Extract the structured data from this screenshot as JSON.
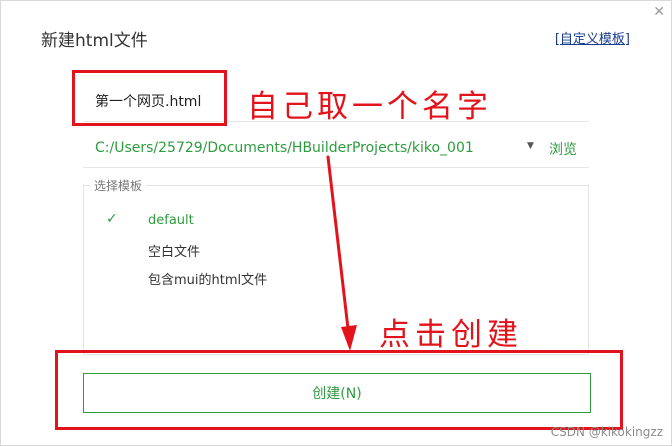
{
  "dialog": {
    "title": "新建html文件",
    "close_glyph": "✕",
    "custom_template_link": "[自定义模板]",
    "filename_value": "第一个网页.html",
    "path_value": "C:/Users/25729/Documents/HBuilderProjects/kiko_001",
    "path_dropdown_glyph": "▼",
    "browse_label": "浏览",
    "template_section_label": "选择模板",
    "templates": [
      {
        "label": "default",
        "selected": true
      },
      {
        "label": "空白文件",
        "selected": false
      },
      {
        "label": "包含mui的html文件",
        "selected": false
      }
    ],
    "check_glyph": "✓",
    "create_button_label": "创建(N)",
    "accent_color": "#2e9c3f"
  },
  "annotations": {
    "name_hint": "自己取一个名字",
    "create_hint": "点击创建",
    "color": "#e3131b"
  },
  "watermark": "CSDN @kikokingzz"
}
